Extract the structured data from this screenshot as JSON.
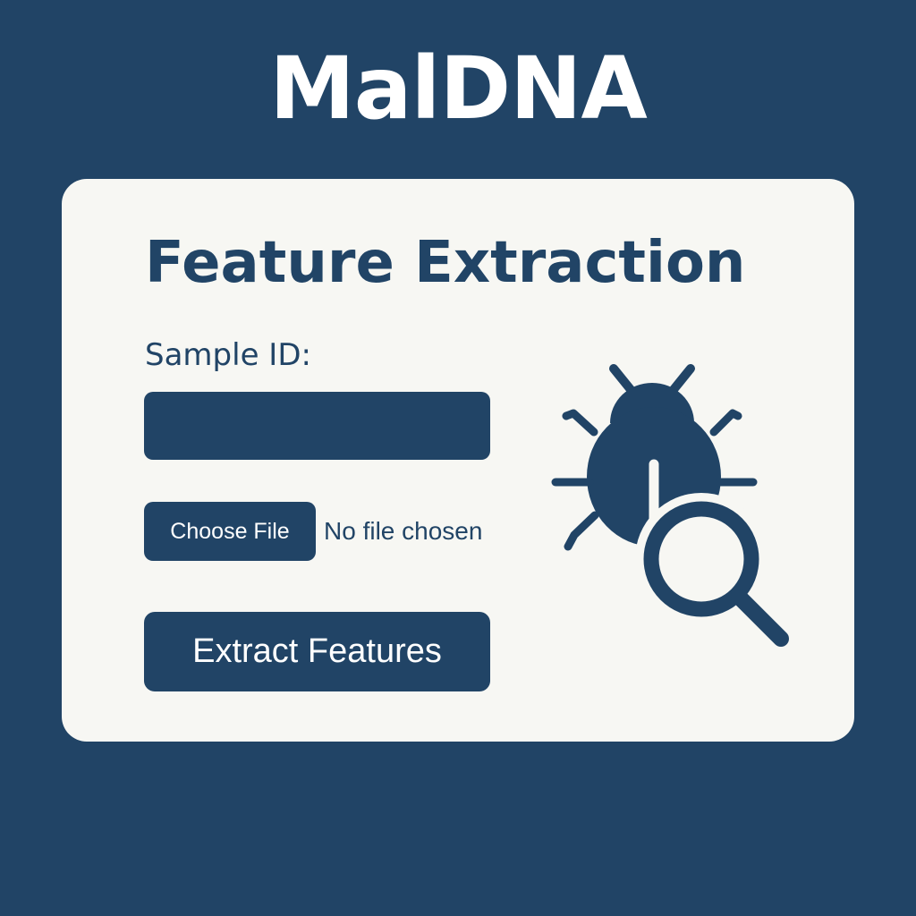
{
  "colors": {
    "background": "#214466",
    "card": "#f7f7f3",
    "accent": "#214466",
    "text_on_accent": "#ffffff"
  },
  "app": {
    "title": "MalDNA"
  },
  "card": {
    "title": "Feature Extraction",
    "sample_id": {
      "label": "Sample ID:",
      "value": "",
      "placeholder": ""
    },
    "file_picker": {
      "button_label": "Choose File",
      "status": "No file chosen"
    },
    "extract_button": {
      "label": "Extract Features"
    },
    "illustration": {
      "icons": [
        "bug-icon",
        "magnifier-icon"
      ]
    }
  }
}
